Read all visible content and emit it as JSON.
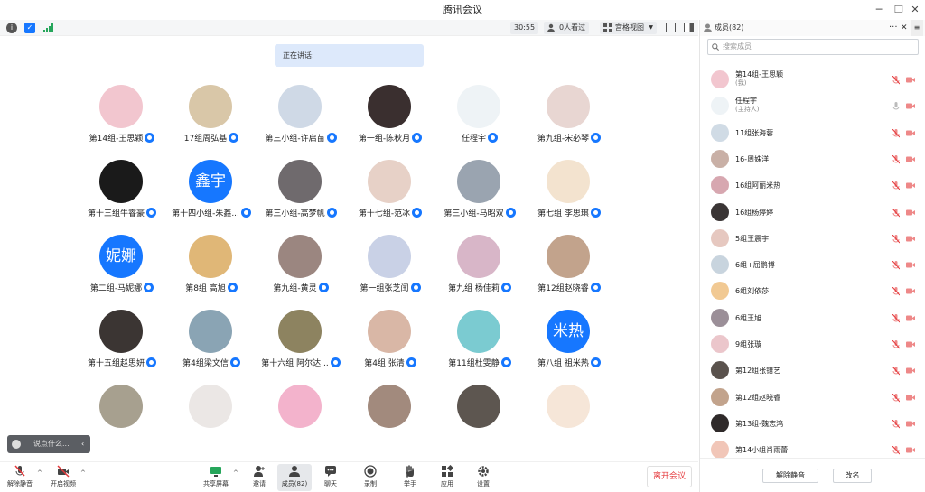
{
  "window": {
    "title": "腾讯会议"
  },
  "topbar": {
    "timer": "30:55",
    "viewers": "0人看过",
    "view_mode": "宫格视图"
  },
  "banner": {
    "speaking_label": "正在讲话:"
  },
  "grid": [
    {
      "name": "第14组-王思颖",
      "avatar": "#f2c6cf"
    },
    {
      "name": "17组周弘基",
      "avatar": "#d9c7a8"
    },
    {
      "name": "第三小组-许启苗",
      "avatar": "#cfd9e6"
    },
    {
      "name": "第一组-陈秋月",
      "avatar": "#3a2f2f"
    },
    {
      "name": "任程宇",
      "avatar": "#eef3f6"
    },
    {
      "name": "第九组-宋必琴",
      "avatar": "#e8d6d2"
    },
    {
      "name": "第十三组牛睿豪",
      "avatar": "#1a1a1a"
    },
    {
      "name": "第十四小组-朱鑫...",
      "avatar_text": "鑫宇"
    },
    {
      "name": "第三小组-高梦帆",
      "avatar": "#6f6a6d"
    },
    {
      "name": "第十七组-范冰",
      "avatar": "#e7d1c7"
    },
    {
      "name": "第三小组-马昭双",
      "avatar": "#9aa4b0"
    },
    {
      "name": "第七组 李思琪",
      "avatar": "#f3e3cf"
    },
    {
      "name": "第二组-马妮娜",
      "avatar_text": "妮娜"
    },
    {
      "name": "第8组 高旭",
      "avatar": "#e0b777"
    },
    {
      "name": "第九组-黄灵",
      "avatar": "#9b8680"
    },
    {
      "name": "第一组张芝闰",
      "avatar": "#c9d1e6"
    },
    {
      "name": "第九组 杨佳莉",
      "avatar": "#d8b6c8"
    },
    {
      "name": "第12组赵晓睿",
      "avatar": "#c2a38c"
    },
    {
      "name": "第十五组赵思妍",
      "avatar": "#3b3533"
    },
    {
      "name": "第4组梁文信",
      "avatar": "#8aa4b4"
    },
    {
      "name": "第十六组 阿尔达...",
      "avatar": "#8d8360"
    },
    {
      "name": "第4组 张清",
      "avatar": "#d9b7a6"
    },
    {
      "name": "第11组杜雯静",
      "avatar": "#7bcbd1"
    },
    {
      "name": "第八组 祖米热",
      "avatar_text": "米热"
    },
    {
      "name": "",
      "avatar": "#a7a08f"
    },
    {
      "name": "",
      "avatar": "#ebe7e5"
    },
    {
      "name": "",
      "avatar": "#f3b3cc"
    },
    {
      "name": "",
      "avatar": "#a28a7d"
    },
    {
      "name": "",
      "avatar": "#5d5650"
    },
    {
      "name": "",
      "avatar": "#f6e6d8"
    }
  ],
  "chat": {
    "placeholder": "说点什么..."
  },
  "bottombar": {
    "mute": "解除静音",
    "video": "开启视频",
    "share": "共享屏幕",
    "invite": "邀请",
    "members": "成员(82)",
    "chat": "聊天",
    "record": "录制",
    "raise": "举手",
    "apps": "应用",
    "settings": "设置",
    "leave": "离开会议"
  },
  "panel": {
    "title": "成员(82)",
    "search_placeholder": "搜索成员",
    "members": [
      {
        "name": "第14组-王思颖",
        "sub": "(我)",
        "color": "#f2c6cf"
      },
      {
        "name": "任程宇",
        "sub": "(主持人)",
        "color": "#eef3f6"
      },
      {
        "name": "11组张海蓉",
        "sub": "",
        "color": "#d0dbe5"
      },
      {
        "name": "16-周姝洋",
        "sub": "",
        "color": "#c9b0a6"
      },
      {
        "name": "16组阿丽米热",
        "sub": "",
        "color": "#d7a7b0"
      },
      {
        "name": "16组杨婷婷",
        "sub": "",
        "color": "#3a3535"
      },
      {
        "name": "5组王震宇",
        "sub": "",
        "color": "#e6c8c0"
      },
      {
        "name": "6组+屈鹏博",
        "sub": "",
        "color": "#c8d4de"
      },
      {
        "name": "6组刘依莎",
        "sub": "",
        "color": "#f1c993"
      },
      {
        "name": "6组王旭",
        "sub": "",
        "color": "#9b8f98"
      },
      {
        "name": "9组张璇",
        "sub": "",
        "color": "#ebc6cb"
      },
      {
        "name": "第12组张镨艺",
        "sub": "",
        "color": "#5a524d"
      },
      {
        "name": "第12组赵晓睿",
        "sub": "",
        "color": "#c2a38c"
      },
      {
        "name": "第13组-魏志鸿",
        "sub": "",
        "color": "#2f2a2a"
      },
      {
        "name": "第14小组肖雨蕾",
        "sub": "",
        "color": "#f1c6b8"
      }
    ],
    "unmute_all": "解除静音",
    "rename": "改名"
  }
}
